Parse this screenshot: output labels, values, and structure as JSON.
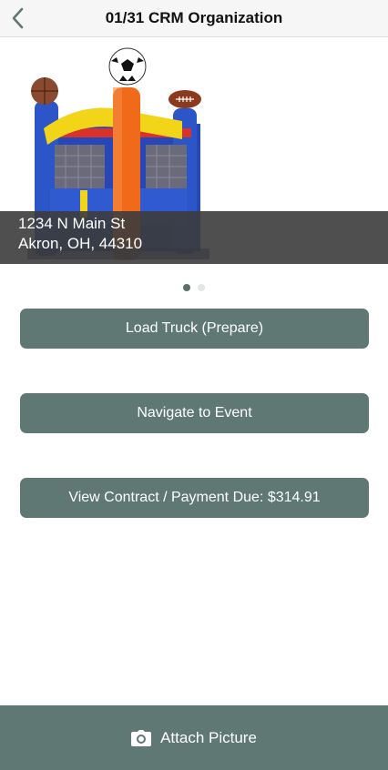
{
  "header": {
    "title": "01/31 CRM Organization",
    "back_icon": "chevron-left-icon",
    "accent_color": "#5f7873"
  },
  "hero": {
    "image": "bounce-house-photo",
    "address_line1": "1234 N Main St",
    "address_line2": "Akron, OH, 44310"
  },
  "pager": {
    "count": 2,
    "active_index": 0
  },
  "actions": {
    "load_truck": "Load Truck (Prepare)",
    "navigate": "Navigate to Event",
    "view_contract": "View Contract / Payment Due: $314.91"
  },
  "footer": {
    "icon": "camera-icon",
    "label": "Attach Picture"
  }
}
